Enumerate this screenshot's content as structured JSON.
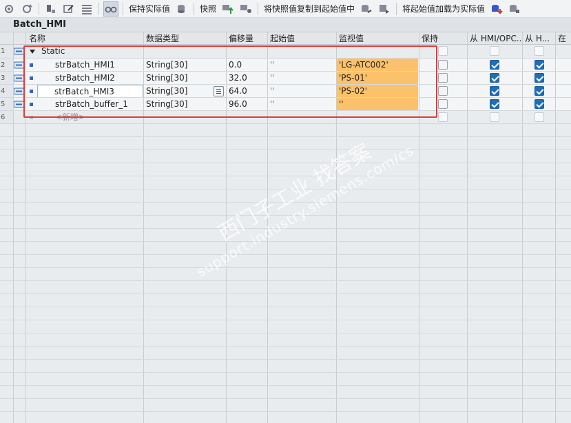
{
  "toolbar": {
    "keep_actual": "保持实际值",
    "snapshot": "快照",
    "copy_snapshot_to_start": "将快照值复制到起始值中",
    "load_start_as_actual": "将起始值加载为实际值"
  },
  "block": {
    "title": "Batch_HMI"
  },
  "columns": {
    "name": "名称",
    "data_type": "数据类型",
    "offset": "偏移量",
    "start_value": "起始值",
    "monitor_value": "监视值",
    "retain": "保持",
    "hmi_opc": "从 HMI/OPC...",
    "from_h": "从 H...",
    "in": "在"
  },
  "rows": [
    {
      "num": "1",
      "name": "Static",
      "type": "",
      "offset": "",
      "start": "",
      "monitor": ""
    },
    {
      "num": "2",
      "name": "strBatch_HMI1",
      "type": "String[30]",
      "offset": "0.0",
      "start": "''",
      "monitor": "'LG-ATC002'"
    },
    {
      "num": "3",
      "name": "strBatch_HMI2",
      "type": "String[30]",
      "offset": "32.0",
      "start": "''",
      "monitor": "'PS-01'"
    },
    {
      "num": "4",
      "name": "strBatch_HMI3",
      "type": "String[30]",
      "offset": "64.0",
      "start": "''",
      "monitor": "'PS-02'"
    },
    {
      "num": "5",
      "name": "strBatch_buffer_1",
      "type": "String[30]",
      "offset": "96.0",
      "start": "''",
      "monitor": "''"
    },
    {
      "num": "6",
      "name": "<新增>",
      "type": "",
      "offset": "",
      "start": "",
      "monitor": ""
    }
  ],
  "watermark": {
    "line1": "西门子工业 找答案",
    "line2": "support.industry.siemens.com/cs"
  },
  "colors": {
    "monitor_bg": "#fbc26b",
    "highlight": "#e53935",
    "checkbox_on": "#1f6fb8"
  }
}
